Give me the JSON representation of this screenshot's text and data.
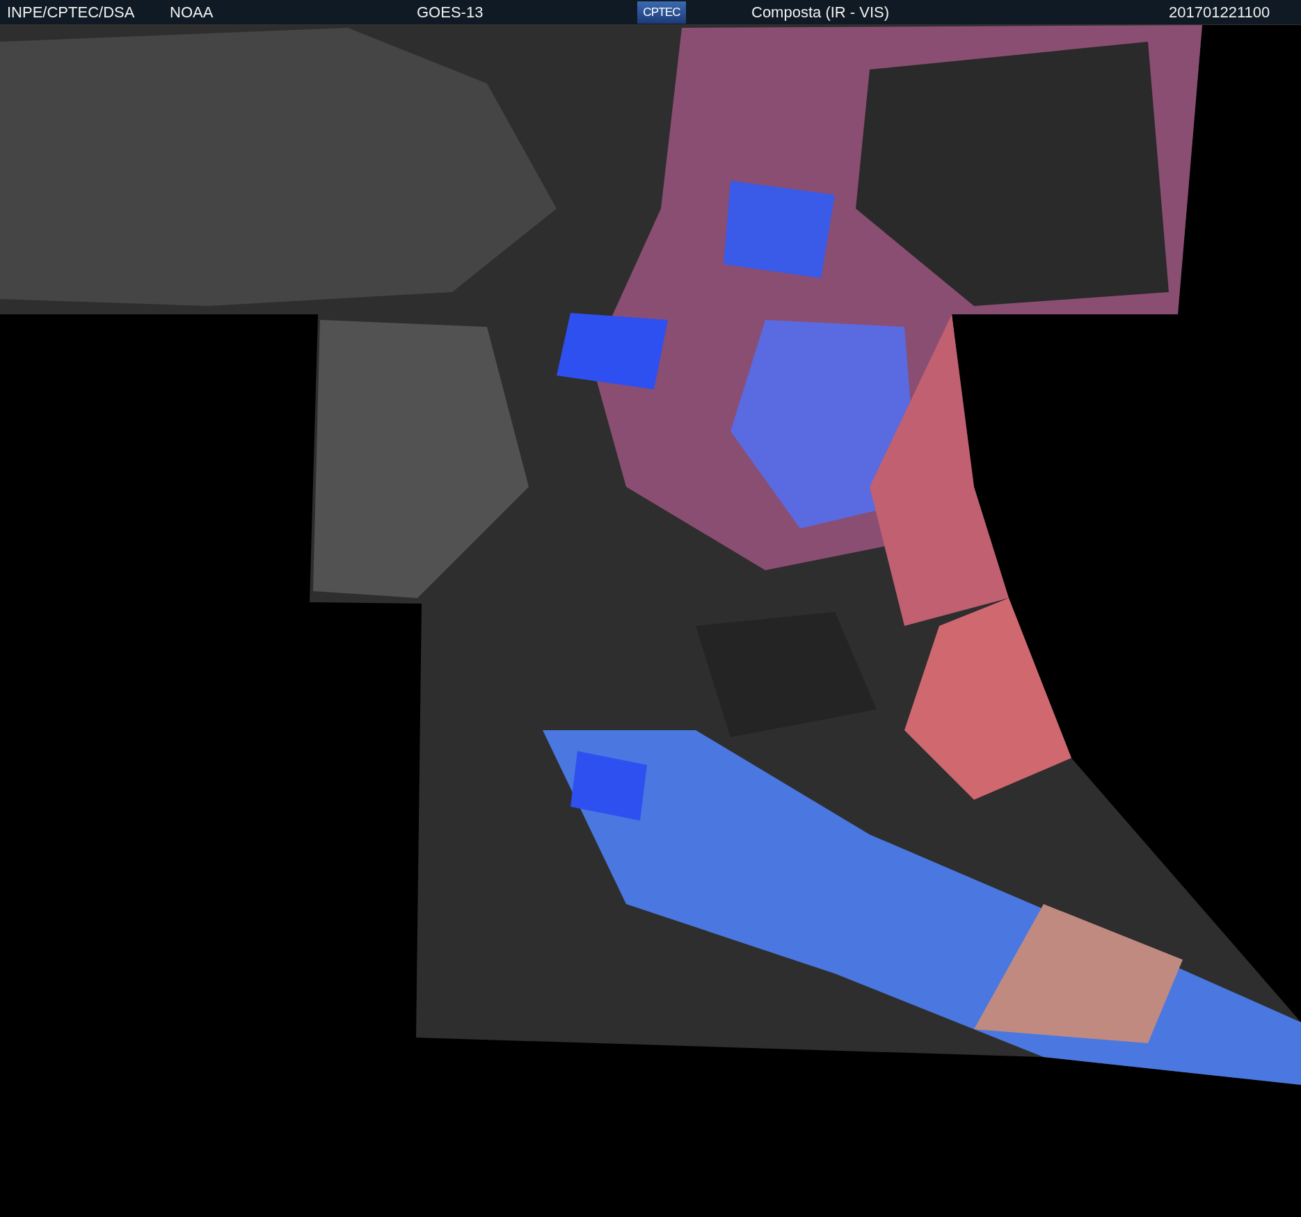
{
  "header": {
    "left_labels": [
      "INPE/CPTEC/DSA",
      "NOAA"
    ],
    "satellite": "GOES-13",
    "logo_text": "CPTEC",
    "product": "Composta (IR - VIS)",
    "timestamp": "201701221100"
  }
}
